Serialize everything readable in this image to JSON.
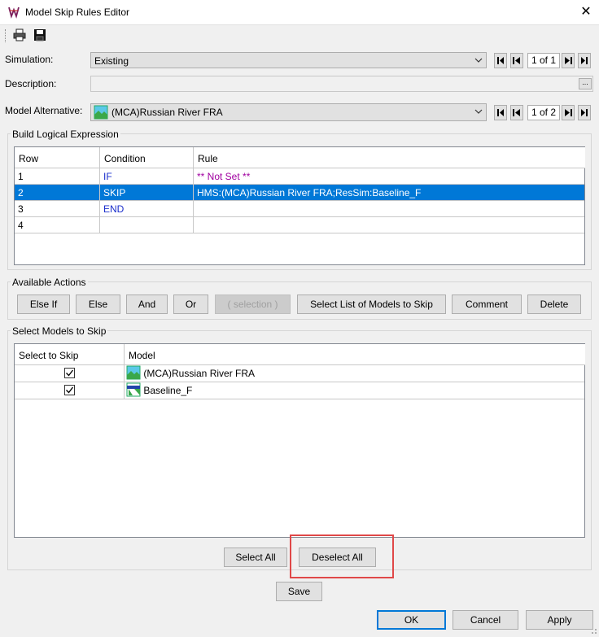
{
  "window": {
    "title": "Model Skip Rules Editor"
  },
  "toolbar": {
    "print_icon": "printer-icon",
    "save_icon": "floppy-disk-icon"
  },
  "simulation": {
    "label": "Simulation:",
    "value": "Existing",
    "nav_count": "1 of 1"
  },
  "description": {
    "label": "Description:",
    "value": "",
    "browse": "..."
  },
  "model_alternative": {
    "label": "Model Alternative:",
    "value": "(MCA)Russian River FRA",
    "nav_count": "1 of 2"
  },
  "build_expression": {
    "title": "Build Logical Expression",
    "columns": [
      "Row",
      "Condition",
      "Rule"
    ],
    "rows": [
      {
        "row": "1",
        "condition": "IF",
        "rule": "** Not Set **"
      },
      {
        "row": "2",
        "condition": "SKIP",
        "rule": "HMS:(MCA)Russian River FRA;ResSim:Baseline_F"
      },
      {
        "row": "3",
        "condition": "END",
        "rule": ""
      },
      {
        "row": "4",
        "condition": "",
        "rule": ""
      }
    ],
    "selected_row": 1
  },
  "actions": {
    "title": "Available Actions",
    "else_if": "Else If",
    "else": "Else",
    "and": "And",
    "or": "Or",
    "selection": "( selection )",
    "select_list": "Select List of Models to Skip",
    "comment": "Comment",
    "delete": "Delete"
  },
  "skip_models": {
    "title": "Select Models to Skip",
    "columns": [
      "Select to Skip",
      "Model"
    ],
    "rows": [
      {
        "checked": true,
        "model": "(MCA)Russian River FRA"
      },
      {
        "checked": true,
        "model": "Baseline_F"
      }
    ],
    "select_all": "Select All",
    "deselect_all": "Deselect All"
  },
  "footer": {
    "save": "Save",
    "ok": "OK",
    "cancel": "Cancel",
    "apply": "Apply"
  },
  "colors": {
    "selection": "#0078d7",
    "keyword": "#1a2ecc",
    "not_set": "#a000a0",
    "highlight": "#e04848"
  }
}
